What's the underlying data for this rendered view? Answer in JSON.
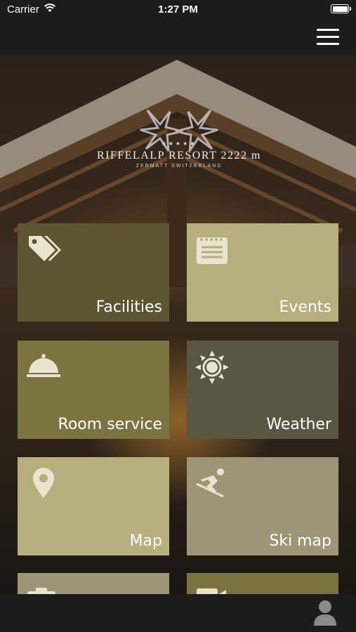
{
  "status_bar": {
    "carrier": "Carrier",
    "time": "1:27 PM"
  },
  "logo": {
    "stars": "★★★★★",
    "name": "RIFFELALP RESORT 2222 m",
    "sub": "ZERMATT SWITZERLAND"
  },
  "tiles": [
    {
      "label": "Facilities",
      "icon": "tag-icon",
      "color": "#5b5532"
    },
    {
      "label": "Events",
      "icon": "calendar-icon",
      "color": "#b6ae7c"
    },
    {
      "label": "Room service",
      "icon": "cloche-icon",
      "color": "#7c7440"
    },
    {
      "label": "Weather",
      "icon": "sun-icon",
      "color": "#5a5641"
    },
    {
      "label": "Map",
      "icon": "map-pin-icon",
      "color": "#b6ae7c"
    },
    {
      "label": "Ski map",
      "icon": "skier-icon",
      "color": "#9c9677"
    },
    {
      "label": "",
      "icon": "camera-icon",
      "color": "#9c9677"
    },
    {
      "label": "",
      "icon": "video-icon",
      "color": "#7c7440"
    }
  ],
  "colors": {
    "bar": "#1c1c1c",
    "icon": "#e8e4cf"
  }
}
